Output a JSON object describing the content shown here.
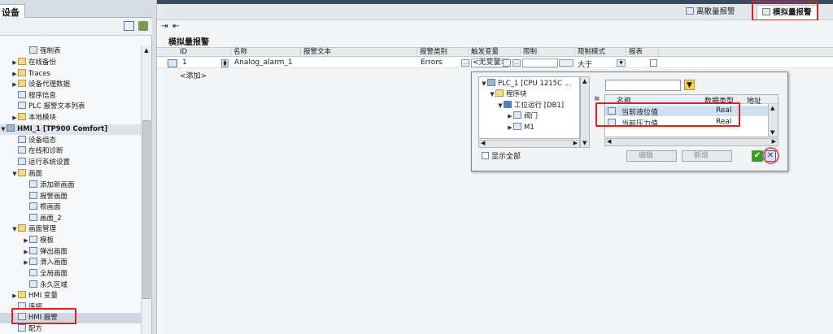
{
  "left_panel": {
    "title": "设备",
    "items": [
      {
        "label": "强制表",
        "indent": 2
      },
      {
        "label": "在线备份",
        "indent": 1
      },
      {
        "label": "Traces",
        "indent": 1
      },
      {
        "label": "设备代理数据",
        "indent": 1
      },
      {
        "label": "程序信息",
        "indent": 1
      },
      {
        "label": "PLC 报警文本列表",
        "indent": 1
      },
      {
        "label": "本地模块",
        "indent": 1
      },
      {
        "label": "HMI_1 [TP900 Comfort]",
        "indent": 0
      },
      {
        "label": "设备组态",
        "indent": 1
      },
      {
        "label": "在线和诊断",
        "indent": 1
      },
      {
        "label": "运行系统设置",
        "indent": 1
      },
      {
        "label": "画面",
        "indent": 1
      },
      {
        "label": "添加新画面",
        "indent": 2
      },
      {
        "label": "报警画面",
        "indent": 2
      },
      {
        "label": "根画面",
        "indent": 2
      },
      {
        "label": "画面_2",
        "indent": 2
      },
      {
        "label": "画面管理",
        "indent": 1
      },
      {
        "label": "模板",
        "indent": 2
      },
      {
        "label": "弹出画面",
        "indent": 2
      },
      {
        "label": "滑入画面",
        "indent": 2
      },
      {
        "label": "全局画面",
        "indent": 2
      },
      {
        "label": "永久区域",
        "indent": 2
      },
      {
        "label": "HMI 变量",
        "indent": 1
      },
      {
        "label": "连接",
        "indent": 1
      },
      {
        "label": "HMI 报警",
        "indent": 1
      },
      {
        "label": "配方",
        "indent": 1
      }
    ]
  },
  "tabs": {
    "discrete": "离散量报警",
    "analog": "模拟量报警"
  },
  "section_title": "模拟量报警",
  "table": {
    "headers": [
      "ID",
      "名称",
      "报警文本",
      "报警类别",
      "触发变量",
      "限制",
      "限制模式",
      "报表"
    ],
    "row": {
      "id": "1",
      "name": "Analog_alarm_1",
      "text": "",
      "class": "Errors",
      "trigger": "<无变量>",
      "limit": "",
      "mode": "大于"
    },
    "add_label": "<添加>"
  },
  "popup": {
    "tree": [
      "PLC_1 [CPU 1215C ...",
      "程序块",
      "工位运行 [DB1]",
      "阀门",
      "M1"
    ],
    "list_headers": [
      "名称",
      "数据类型",
      "地址"
    ],
    "list_rows": [
      {
        "name": "当前液位值",
        "type": "Real"
      },
      {
        "name": "当前压力值",
        "type": "Real"
      }
    ],
    "show_all": "显示全部",
    "edit_label": "编辑",
    "new_label": "新增"
  }
}
